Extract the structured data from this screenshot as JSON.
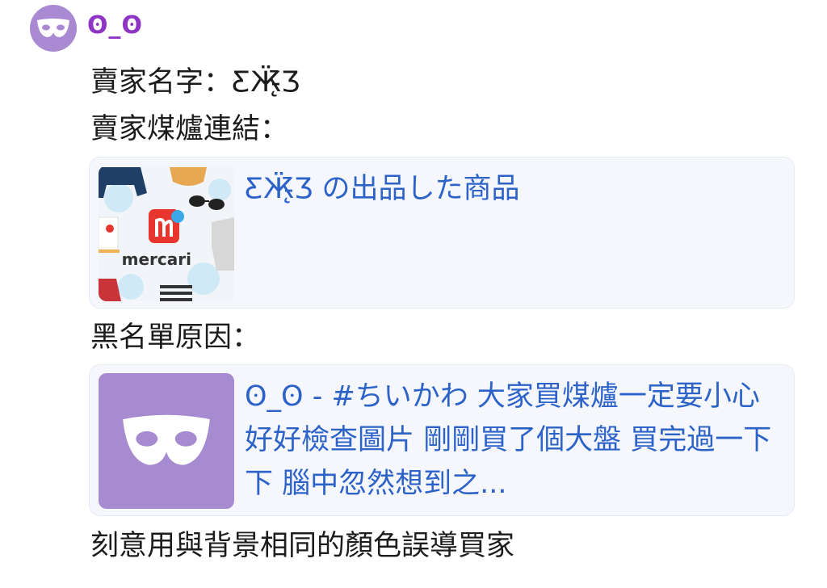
{
  "message": {
    "username": "ʘ_ʘ",
    "avatar_icon": "mask-icon",
    "seller_name_line": "賣家名字：ƸӜ̵̨̄Ʒ",
    "seller_link_label": "賣家煤爐連結：",
    "link_card_1": {
      "thumbnail": "mercari-logo",
      "thumbnail_text": "mercari",
      "title": "ƸӜ̵̨̄Ʒ の出品した商品"
    },
    "reason_label": "黑名單原因：",
    "link_card_2": {
      "thumbnail_icon": "mask-icon",
      "title": "ʘ_ʘ - #ちいかわ 大家買煤爐一定要小心 好好檢查圖片 剛剛買了個大盤 買完過一下下 腦中忽然想到之..."
    },
    "footer_text": "刻意用與背景相同的顏色誤導買家"
  },
  "colors": {
    "username": "#8e35c6",
    "link": "#2d63c9",
    "avatar_bg": "#a98ad2",
    "card_bg": "#f5f7fc",
    "mercari_red": "#e8352d"
  }
}
